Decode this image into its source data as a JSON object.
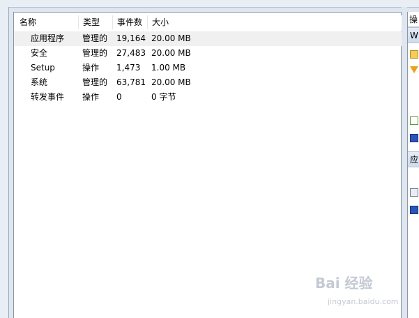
{
  "columns": {
    "name": "名称",
    "type": "类型",
    "count": "事件数",
    "size": "大小"
  },
  "rows": [
    {
      "name": "应用程序",
      "type": "管理的",
      "count": "19,164",
      "size": "20.00 MB"
    },
    {
      "name": "安全",
      "type": "管理的",
      "count": "27,483",
      "size": "20.00 MB"
    },
    {
      "name": "Setup",
      "type": "操作",
      "count": "1,473",
      "size": "1.00 MB"
    },
    {
      "name": "系统",
      "type": "管理的",
      "count": "63,781",
      "size": "20.00 MB"
    },
    {
      "name": "转发事件",
      "type": "操作",
      "count": "0",
      "size": "0 字节"
    }
  ],
  "actions_pane": {
    "title": "操",
    "section1": "W",
    "section2": "应"
  },
  "watermark": {
    "brand": "Bai 经验",
    "url": "jingyan.baidu.com"
  }
}
